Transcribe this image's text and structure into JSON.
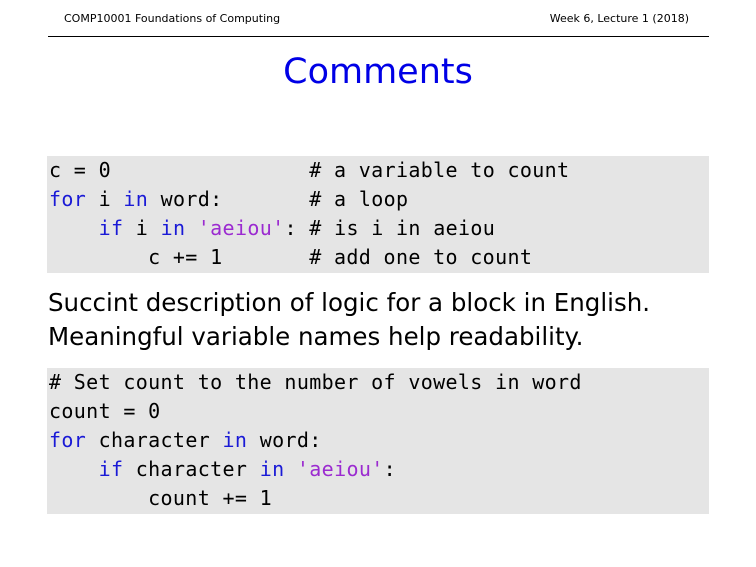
{
  "header": {
    "course": "COMP10001 Foundations of Computing",
    "lecture": "Week 6, Lecture 1 (2018)"
  },
  "slide": {
    "title": "Comments"
  },
  "code_block_1": {
    "lines": [
      [
        {
          "t": "c = 0                "
        },
        {
          "t": "# a variable to count"
        }
      ],
      [
        {
          "t": "for",
          "k": "kw"
        },
        {
          "t": " i "
        },
        {
          "t": "in",
          "k": "kw"
        },
        {
          "t": " word:       # a loop"
        }
      ],
      [
        {
          "t": "    "
        },
        {
          "t": "if",
          "k": "kw"
        },
        {
          "t": " i "
        },
        {
          "t": "in",
          "k": "kw"
        },
        {
          "t": " "
        },
        {
          "t": "'aeiou'",
          "k": "str"
        },
        {
          "t": ": # is i in aeiou"
        }
      ],
      [
        {
          "t": "        c += 1       # add one to count"
        }
      ]
    ]
  },
  "prose": {
    "line1": "Succint description of logic for a block in English.",
    "line2": "Meaningful variable names help readability."
  },
  "code_block_2": {
    "lines": [
      [
        {
          "t": "# Set count to the number of vowels in word"
        }
      ],
      [
        {
          "t": "count = 0"
        }
      ],
      [
        {
          "t": "for",
          "k": "kw"
        },
        {
          "t": " character "
        },
        {
          "t": "in",
          "k": "kw"
        },
        {
          "t": " word:"
        }
      ],
      [
        {
          "t": "    "
        },
        {
          "t": "if",
          "k": "kw"
        },
        {
          "t": " character "
        },
        {
          "t": "in",
          "k": "kw"
        },
        {
          "t": " "
        },
        {
          "t": "'aeiou'",
          "k": "str"
        },
        {
          "t": ":"
        }
      ],
      [
        {
          "t": "        count += 1"
        }
      ]
    ]
  }
}
